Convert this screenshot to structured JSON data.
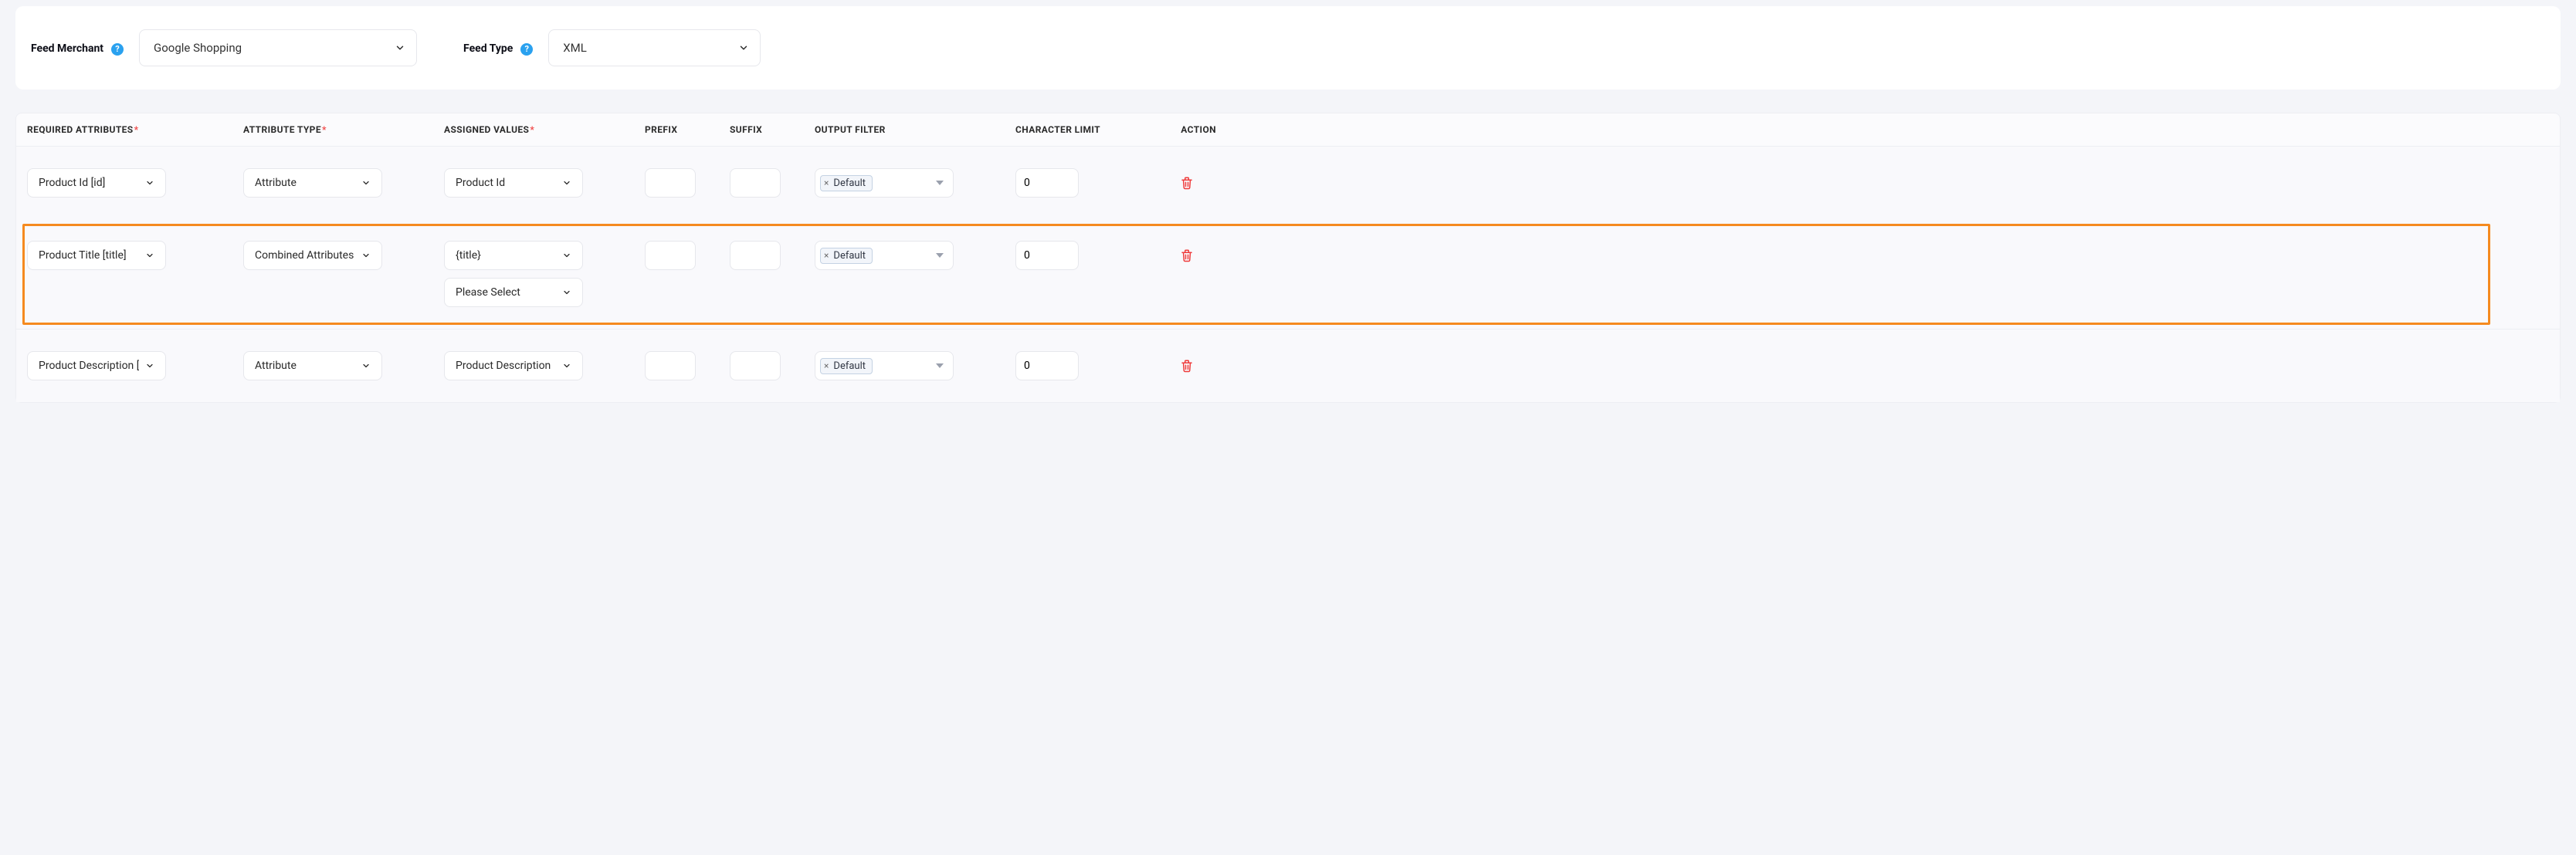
{
  "top": {
    "merchant_label": "Feed Merchant",
    "merchant_value": "Google Shopping",
    "type_label": "Feed Type",
    "type_value": "XML"
  },
  "headers": {
    "required": "REQUIRED ATTRIBUTES",
    "attr_type": "ATTRIBUTE TYPE",
    "assigned": "ASSIGNED VALUES",
    "prefix": "PREFIX",
    "suffix": "SUFFIX",
    "output_filter": "OUTPUT FILTER",
    "char_limit": "CHARACTER LIMIT",
    "action": "ACTION"
  },
  "rows": [
    {
      "required": "Product Id [id]",
      "attr_type": "Attribute",
      "assigned": [
        "Product Id"
      ],
      "extra_select": null,
      "prefix": "",
      "suffix": "",
      "filter_tag": "Default",
      "char_limit": "0",
      "highlight": false
    },
    {
      "required": "Product Title [title]",
      "attr_type": "Combined Attributes",
      "assigned": [
        "{title}"
      ],
      "extra_select": "Please Select",
      "prefix": "",
      "suffix": "",
      "filter_tag": "Default",
      "char_limit": "0",
      "highlight": true
    },
    {
      "required": "Product Description [description]",
      "attr_type": "Attribute",
      "assigned": [
        "Product Description"
      ],
      "extra_select": null,
      "prefix": "",
      "suffix": "",
      "filter_tag": "Default",
      "char_limit": "0",
      "highlight": false
    }
  ]
}
